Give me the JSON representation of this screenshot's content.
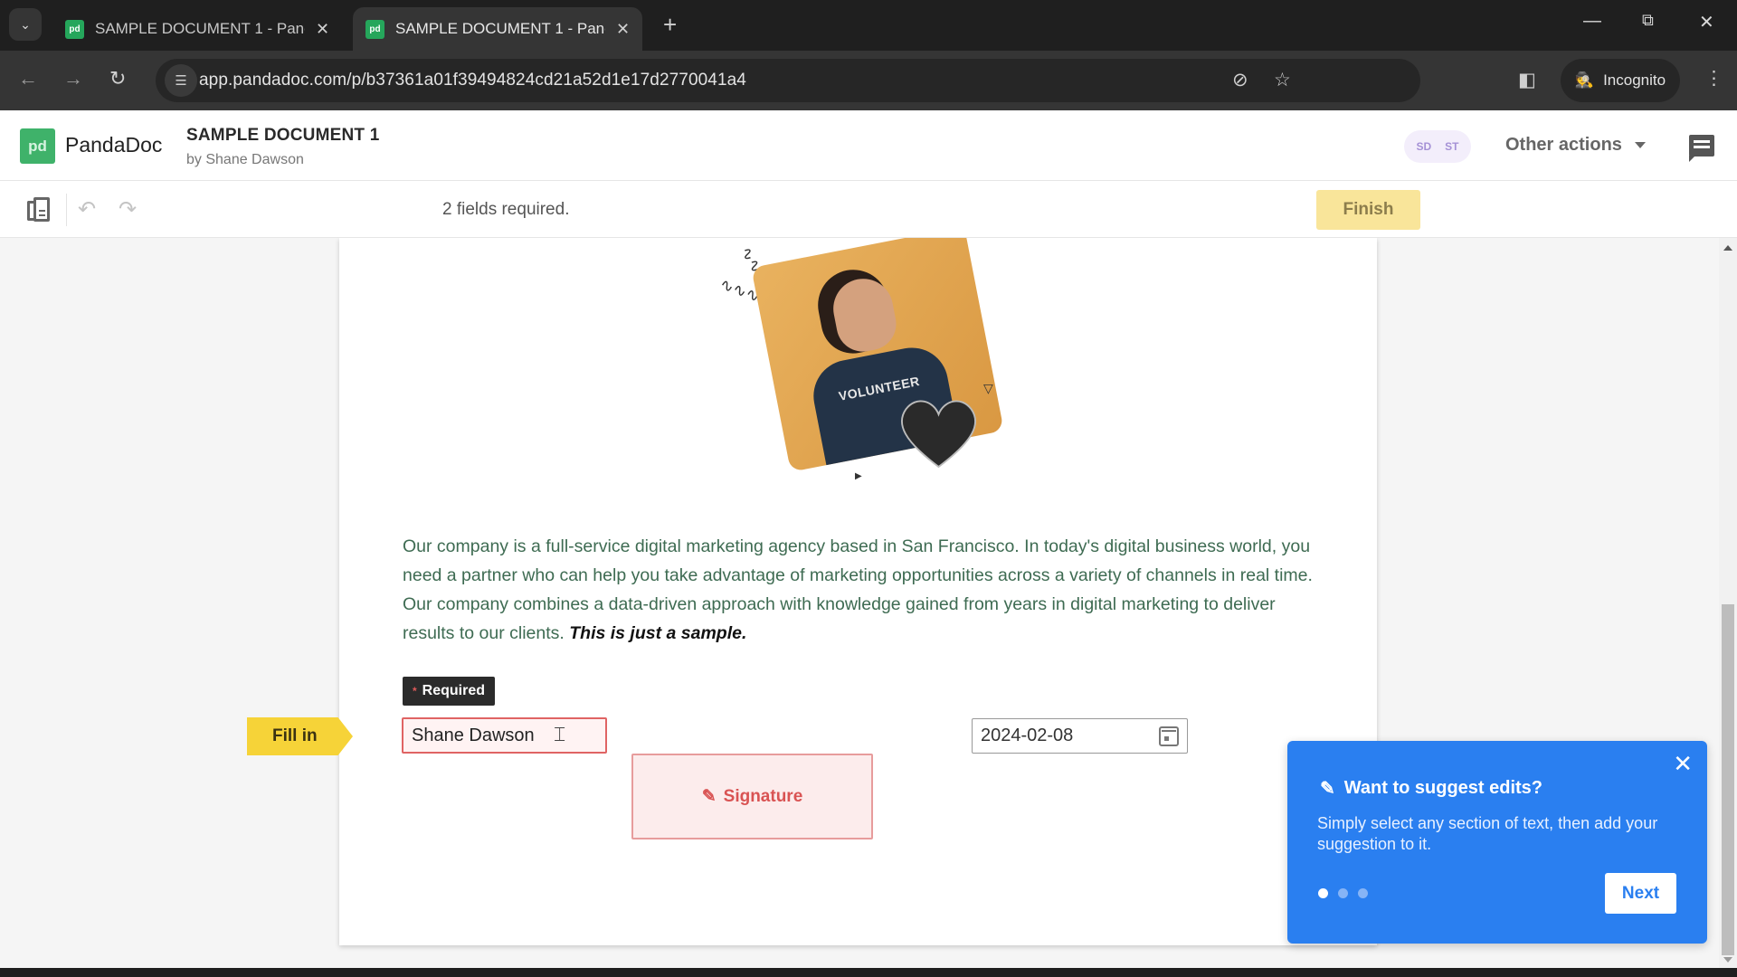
{
  "browser": {
    "tabs": [
      {
        "title": "SAMPLE DOCUMENT 1 - PandaDoc",
        "favicon": "pd",
        "active": false
      },
      {
        "title": "SAMPLE DOCUMENT 1 - PandaDoc",
        "favicon": "pd",
        "active": true
      }
    ],
    "new_tab_label": "+",
    "url": "app.pandadoc.com/p/b37361a01f39494824cd21a52d1e17d2770041a4",
    "incognito_label": "Incognito",
    "icons": {
      "tab_menu": "chevron-down-icon",
      "back": "arrow-left-icon",
      "forward": "arrow-right-icon",
      "reload": "reload-icon",
      "site_info": "tune-icon",
      "eye_off": "eye-off-icon",
      "bookmark": "star-icon",
      "side_panel": "side-panel-icon",
      "menu": "kebab-menu-icon"
    }
  },
  "app": {
    "logo_mark": "pd",
    "logo_text": "PandaDoc",
    "doc_title": "SAMPLE DOCUMENT 1",
    "doc_author": "by Shane Dawson",
    "avatars": [
      "SD",
      "ST"
    ],
    "other_actions_label": "Other actions"
  },
  "toolbar": {
    "fields_required": "2 fields required.",
    "finish_label": "Finish"
  },
  "document": {
    "image_text": "VOLUNTEER",
    "paragraph": "Our company is a full-service digital marketing agency based in San Francisco. In today's digital business world, you need a partner who can help you take advantage of marketing opportunities across a variety of channels in real time. Our company combines a data-driven approach with knowledge gained from years in digital marketing to deliver results to our clients.",
    "paragraph_emphasis": "This is just a sample.",
    "required_label": "Required",
    "fill_in_label": "Fill in",
    "name_value": "Shane Dawson",
    "signature_label": "Signature",
    "date_value": "2024-02-08"
  },
  "popup": {
    "title": "Want to suggest edits?",
    "body": "Simply select any section of text, then add your suggestion to it.",
    "step": 1,
    "total_steps": 3,
    "next_label": "Next"
  },
  "colors": {
    "brand_green": "#3fb26a",
    "finish_bg": "#f9e59a",
    "required_red": "#e06464",
    "fill_in_yellow": "#f6d338",
    "popup_blue": "#2a7ff0",
    "paragraph_text": "#3e6b52"
  }
}
